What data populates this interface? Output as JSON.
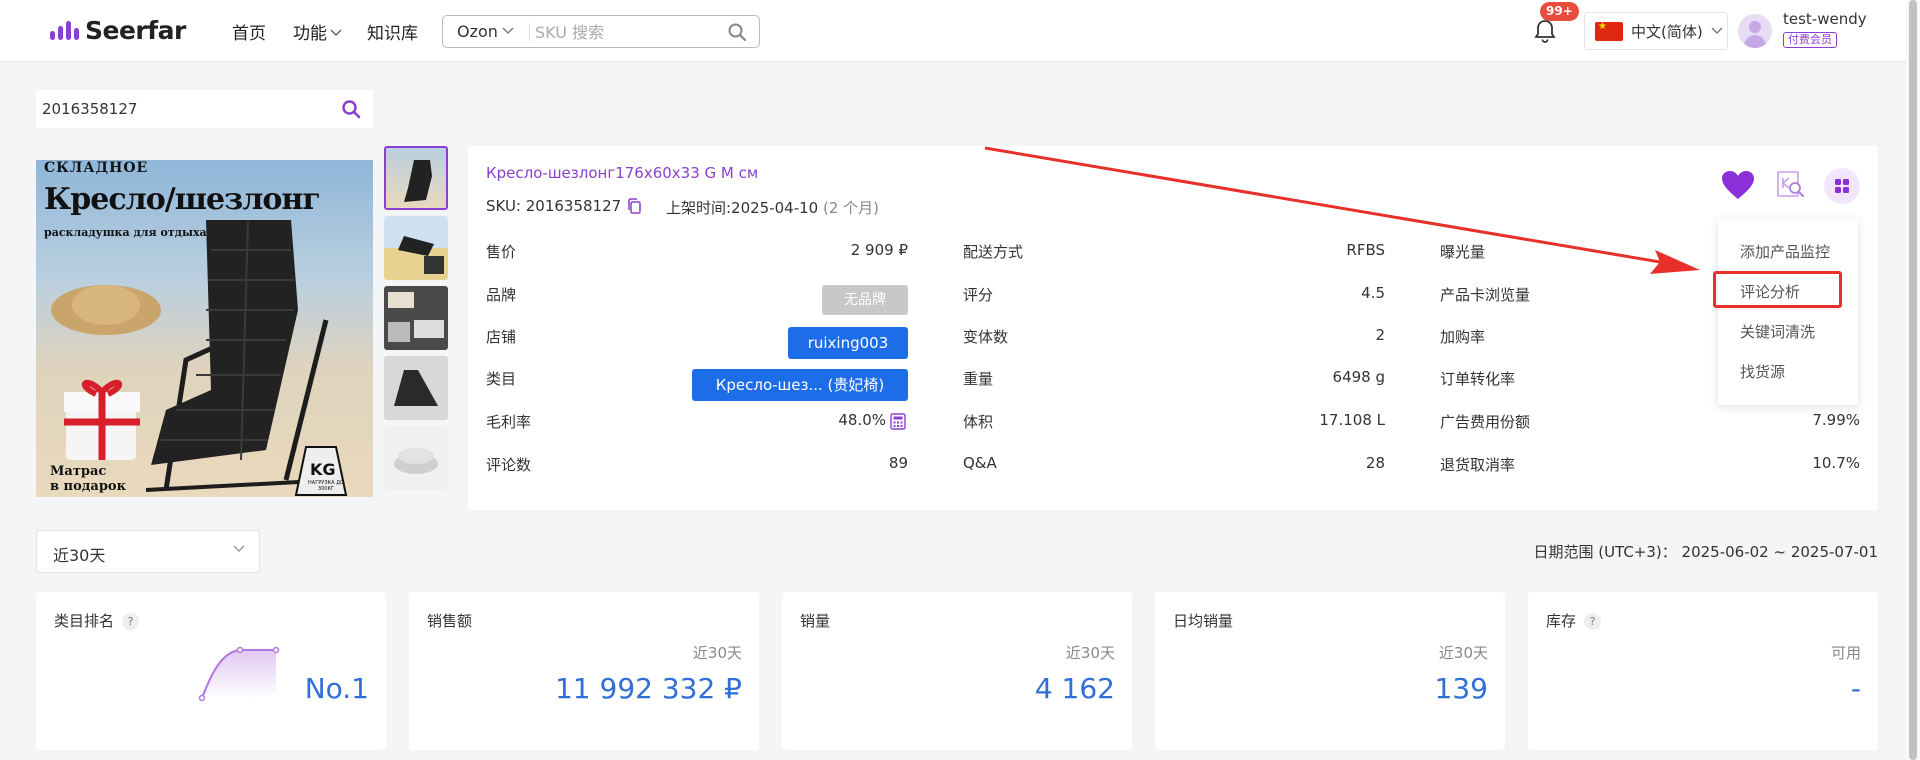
{
  "app": {
    "brand": "Seerfar"
  },
  "header": {
    "nav": [
      "首页",
      "功能",
      "知识库"
    ],
    "marketplace": "Ozon",
    "search_placeholder": "SKU 搜索",
    "notifications": "99+",
    "language": "中文(简体)",
    "user": {
      "name": "test-wendy",
      "badge": "付费会员"
    }
  },
  "sku_search": {
    "value": "2016358127"
  },
  "product_image": {
    "line1": "СКЛАДНОЕ",
    "line2": "Кресло/шезлонг",
    "line3": "раскладушка для отдыха",
    "line4": "Матрас",
    "line5": "в подарок",
    "kg": "KG",
    "kg_sub": "НАГРУЗКА ДО 300КГ"
  },
  "product": {
    "title": "Кресло-шезлонг176x60x33 G M см",
    "sku_label": "SKU: 2016358127",
    "listed_label": "上架时间:2025-04-10",
    "listed_age": "(2 个月)",
    "col1": [
      {
        "label": "售价",
        "value": "2 909 ₽"
      },
      {
        "label": "品牌",
        "value": "无品牌"
      },
      {
        "label": "店铺",
        "value": "ruixing003"
      },
      {
        "label": "类目",
        "value": "Кресло-шез... (贵妃椅)"
      },
      {
        "label": "毛利率",
        "value": "48.0%"
      },
      {
        "label": "评论数",
        "value": "89"
      }
    ],
    "col2": [
      {
        "label": "配送方式",
        "value": "RFBS"
      },
      {
        "label": "评分",
        "value": "4.5"
      },
      {
        "label": "变体数",
        "value": "2"
      },
      {
        "label": "重量",
        "value": "6498 g"
      },
      {
        "label": "体积",
        "value": "17.108 L"
      },
      {
        "label": "Q&A",
        "value": "28"
      }
    ],
    "col3": [
      {
        "label": "曝光量",
        "value": ""
      },
      {
        "label": "产品卡浏览量",
        "value": ""
      },
      {
        "label": "加购率",
        "value": ""
      },
      {
        "label": "订单转化率",
        "value": ""
      },
      {
        "label": "广告费用份额",
        "value": "7.99%"
      },
      {
        "label": "退货取消率",
        "value": "10.7%"
      }
    ]
  },
  "menu": {
    "items": [
      "添加产品监控",
      "评论分析",
      "关键词清洗",
      "找货源"
    ],
    "highlighted": "评论分析"
  },
  "filter": {
    "period": "近30天",
    "date_range": "日期范围 (UTC+3)： 2025-06-02 ~ 2025-07-01"
  },
  "stats": [
    {
      "title": "类目排名",
      "has_help": true,
      "sub": "",
      "value": "No.1"
    },
    {
      "title": "销售额",
      "has_help": false,
      "sub": "近30天",
      "value": "11 992 332 ₽"
    },
    {
      "title": "销量",
      "has_help": false,
      "sub": "近30天",
      "value": "4 162"
    },
    {
      "title": "日均销量",
      "has_help": false,
      "sub": "近30天",
      "value": "139"
    },
    {
      "title": "库存",
      "has_help": true,
      "sub": "可用",
      "value": "-"
    }
  ],
  "colors": {
    "brand": "#8b3fd0",
    "primary_blue": "#1e6de8",
    "stat_blue": "#2f6fd6",
    "highlight_red": "#e8302a"
  }
}
